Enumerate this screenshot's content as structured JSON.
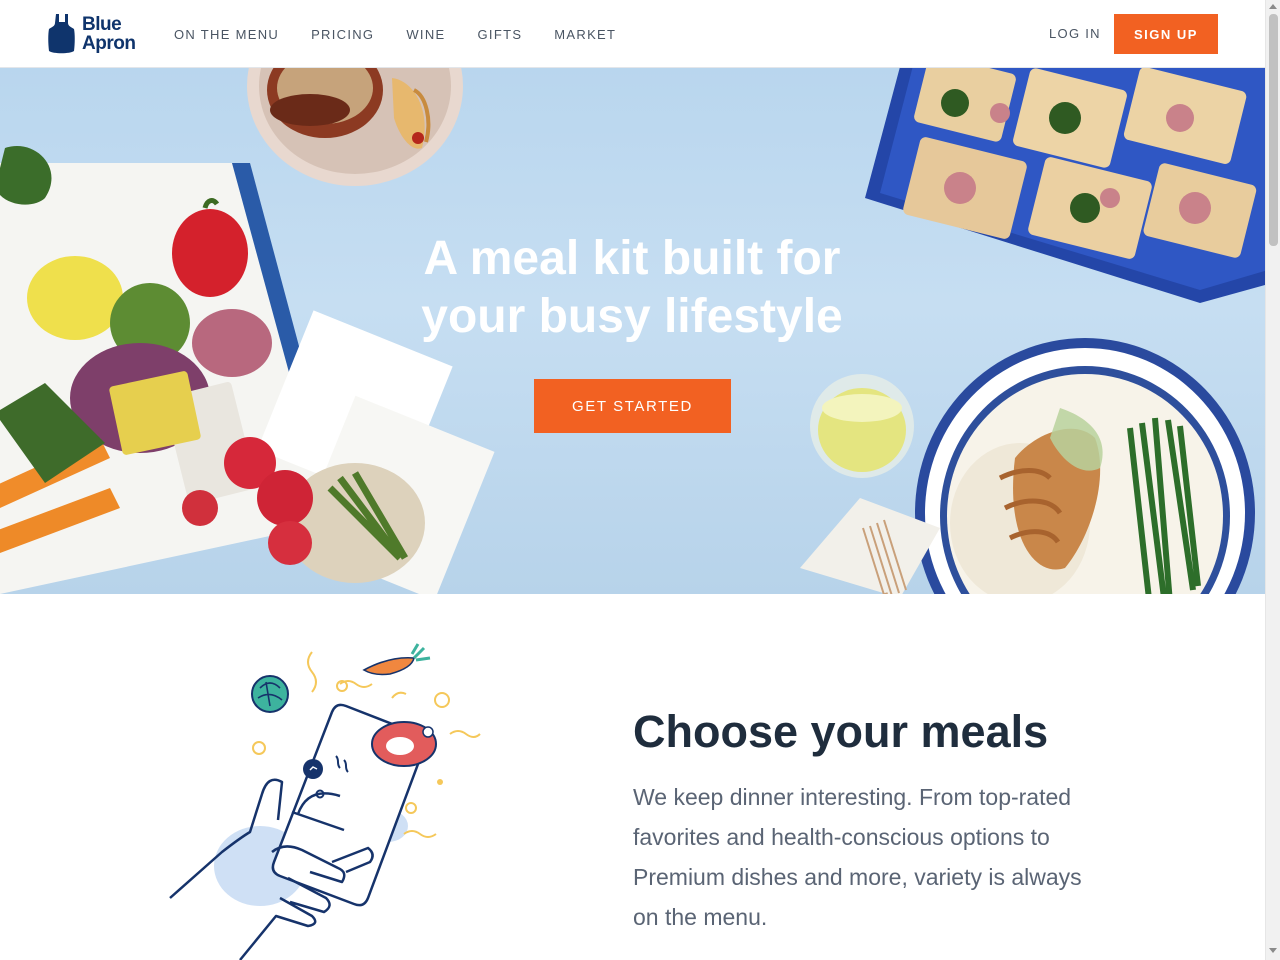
{
  "header": {
    "logo_text_line1": "Blue",
    "logo_text_line2": "Apron",
    "nav": [
      {
        "label": "ON THE MENU"
      },
      {
        "label": "PRICING"
      },
      {
        "label": "WINE"
      },
      {
        "label": "GIFTS"
      },
      {
        "label": "MARKET"
      }
    ],
    "login_label": "LOG IN",
    "signup_label": "SIGN UP"
  },
  "hero": {
    "title_line1": "A meal kit built for",
    "title_line2": "your busy lifestyle",
    "cta_label": "GET STARTED",
    "decor_icons": [
      "burger-plate-icon",
      "pizza-tray-icon",
      "vegetable-box-icon",
      "chicken-rice-plate-icon",
      "fork-icon",
      "wine-glass-icon"
    ]
  },
  "section": {
    "title": "Choose your meals",
    "body": "We keep dinner interesting. From top-rated favorites and health-conscious options to Premium dishes and more, variety is always on the menu.",
    "illustration_icons": [
      "hand-phone-icon",
      "lettuce-icon",
      "carrot-icon",
      "steak-icon",
      "cloche-icon"
    ]
  },
  "colors": {
    "brand_navy": "#0f346c",
    "accent_orange": "#f26122",
    "hero_blue": "#c6def2",
    "text_dark": "#1f2d3d",
    "text_muted": "#5a6474"
  }
}
